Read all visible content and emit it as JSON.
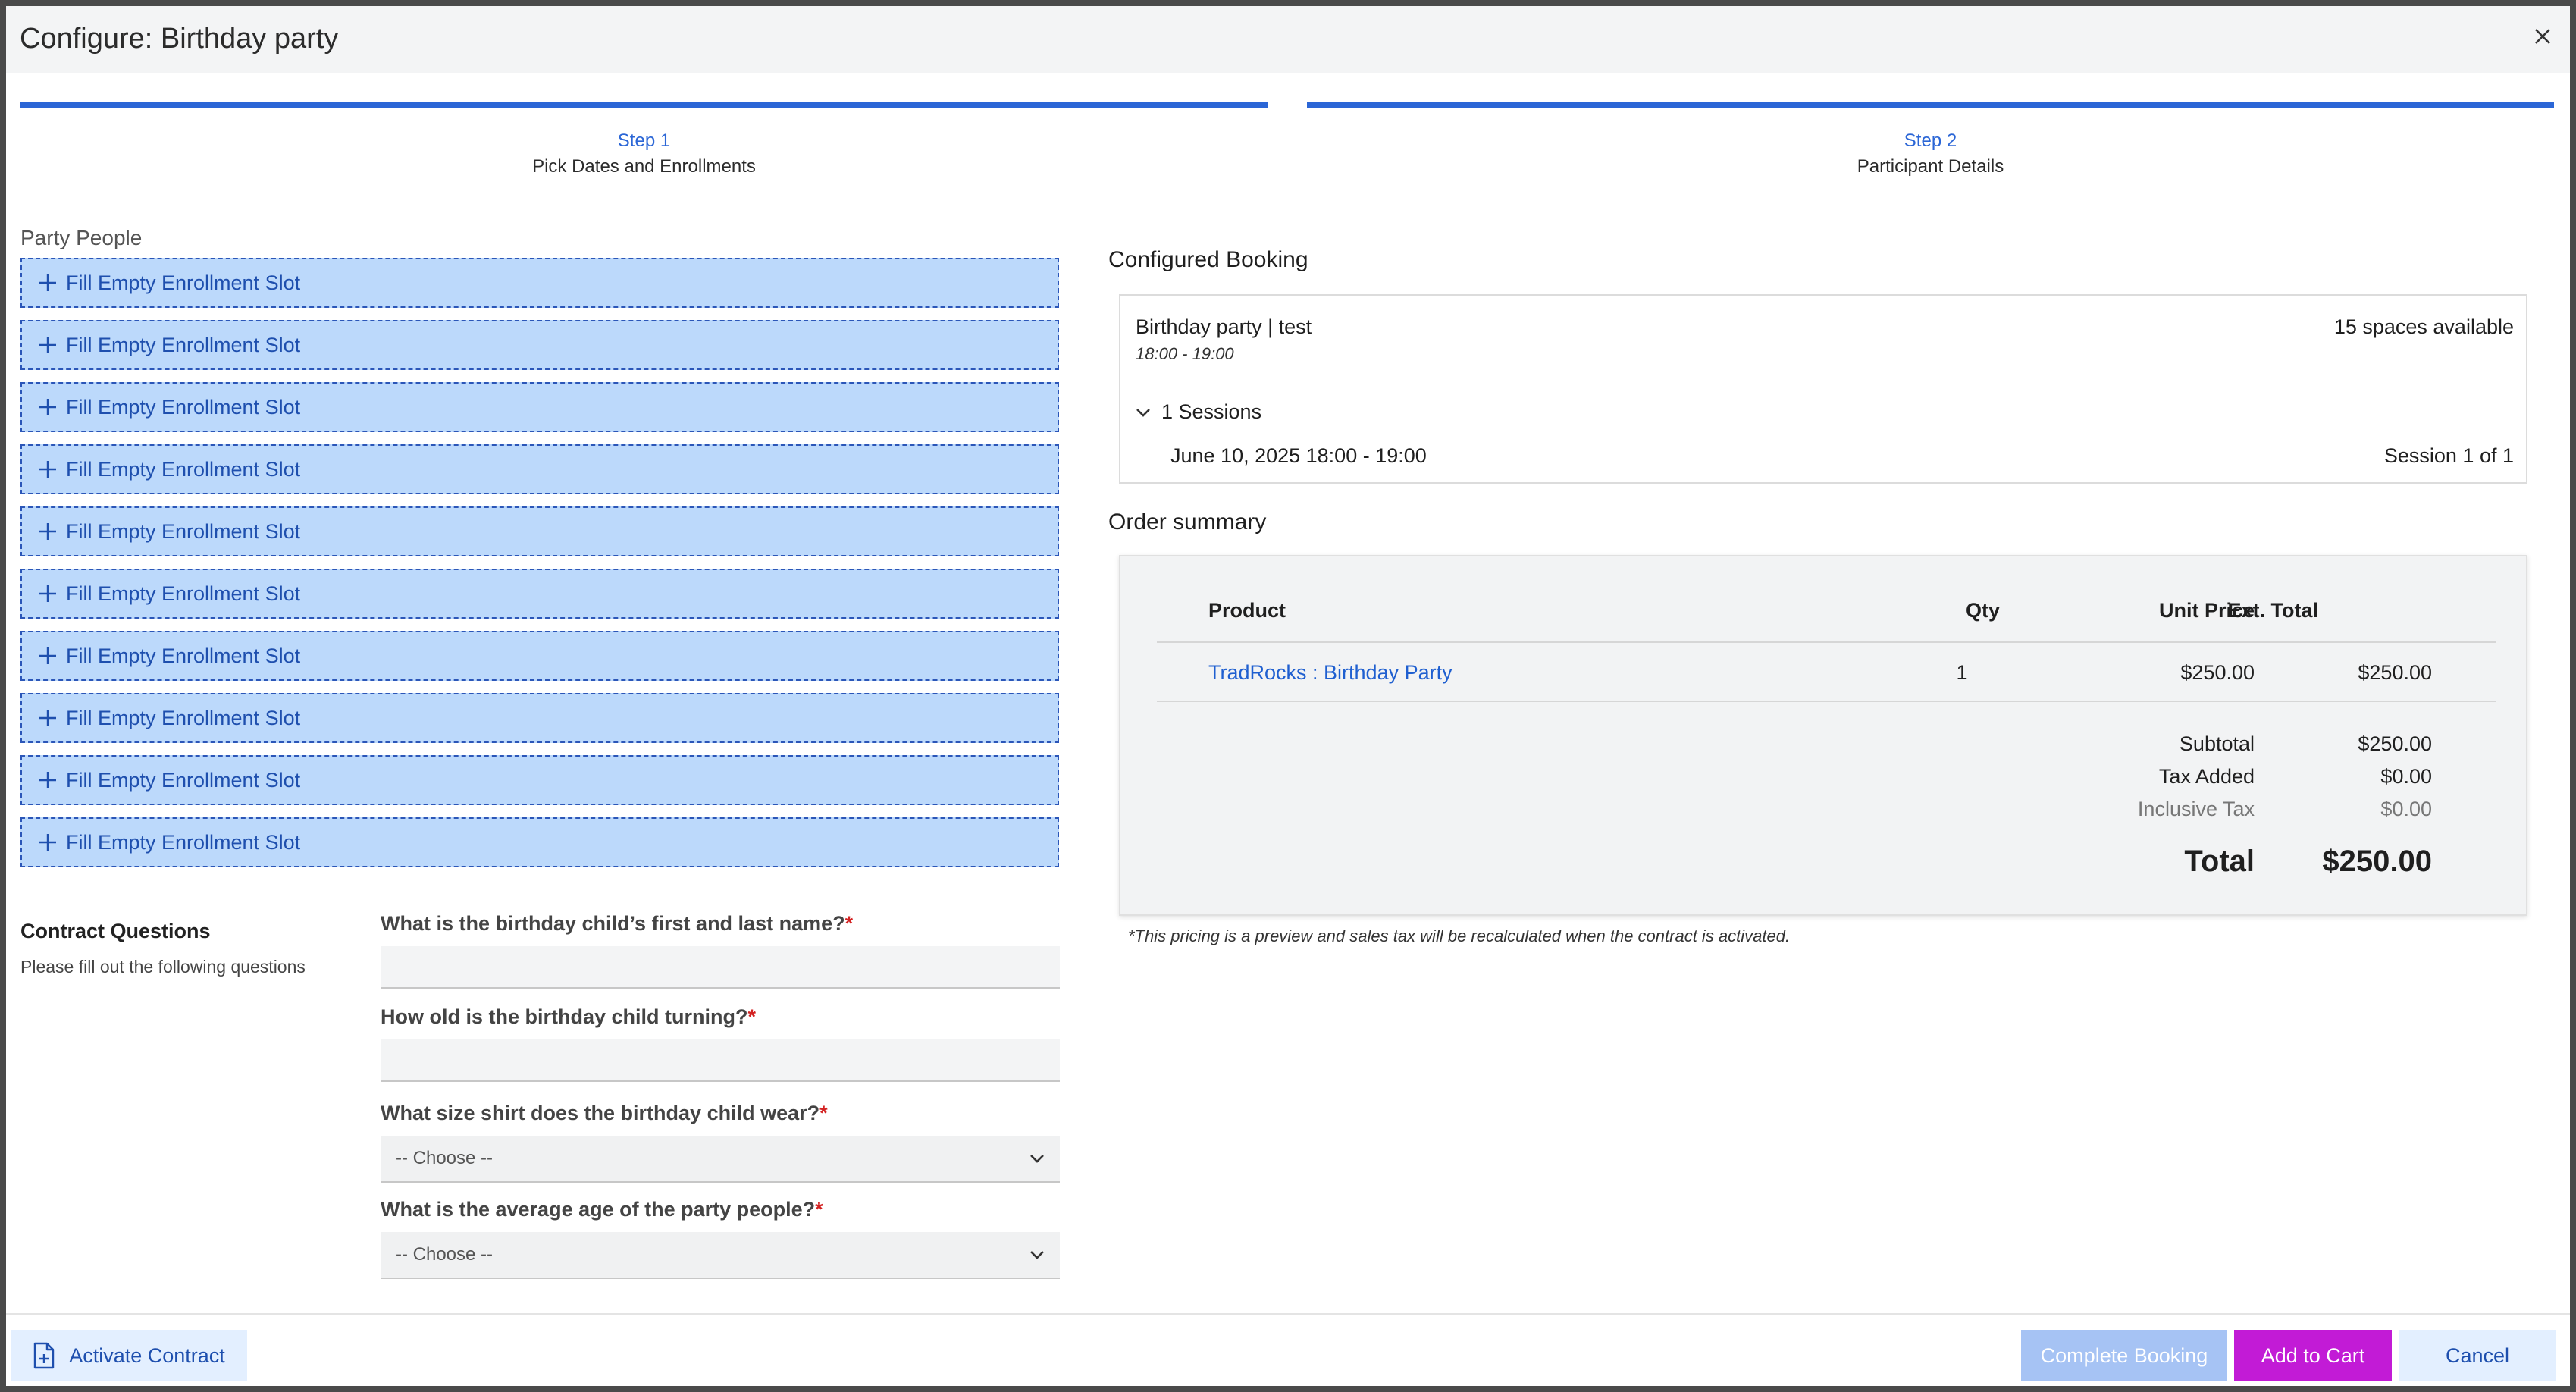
{
  "header": {
    "title": "Configure: Birthday party"
  },
  "steps": [
    {
      "num": "Step 1",
      "label": "Pick Dates and Enrollments"
    },
    {
      "num": "Step 2",
      "label": "Participant Details"
    }
  ],
  "party": {
    "label": "Party People",
    "slot_label": "Fill Empty Enrollment Slot",
    "slots": [
      "Fill Empty Enrollment Slot",
      "Fill Empty Enrollment Slot",
      "Fill Empty Enrollment Slot",
      "Fill Empty Enrollment Slot",
      "Fill Empty Enrollment Slot",
      "Fill Empty Enrollment Slot",
      "Fill Empty Enrollment Slot",
      "Fill Empty Enrollment Slot",
      "Fill Empty Enrollment Slot",
      "Fill Empty Enrollment Slot"
    ]
  },
  "contract": {
    "title": "Contract Questions",
    "subtitle": "Please fill out the following questions",
    "questions": [
      {
        "label": "What is the birthday child’s first and last name?",
        "type": "text",
        "value": ""
      },
      {
        "label": "How old is the birthday child turning?",
        "type": "text",
        "value": ""
      },
      {
        "label": "What size shirt does the birthday child wear?",
        "type": "select",
        "value": "-- Choose --"
      },
      {
        "label": "What is the average age of the party people?",
        "type": "select",
        "value": "-- Choose --"
      }
    ],
    "required_mark": "*"
  },
  "booking": {
    "heading": "Configured Booking",
    "name": "Birthday party | test",
    "time": "18:00 - 19:00",
    "spaces": "15 spaces available",
    "sessions_label": "1 Sessions",
    "session_date": "June 10, 2025 18:00 - 19:00",
    "session_of": "Session 1 of 1"
  },
  "order": {
    "heading": "Order summary",
    "columns": {
      "product": "Product",
      "qty": "Qty",
      "unit": "Unit Price",
      "ext": "Ext. Total"
    },
    "row": {
      "product": "TradRocks : Birthday Party",
      "qty": "1",
      "unit": "$250.00",
      "ext": "$250.00"
    },
    "subtotal_label": "Subtotal",
    "subtotal": "$250.00",
    "tax_label": "Tax Added",
    "tax": "$0.00",
    "incl_label": "Inclusive Tax",
    "incl": "$0.00",
    "total_label": "Total",
    "total": "$250.00",
    "note": "*This pricing is a preview and sales tax will be recalculated when the contract is activated."
  },
  "footer": {
    "activate": "Activate Contract",
    "complete": "Complete Booking",
    "cart": "Add to Cart",
    "cancel": "Cancel"
  }
}
